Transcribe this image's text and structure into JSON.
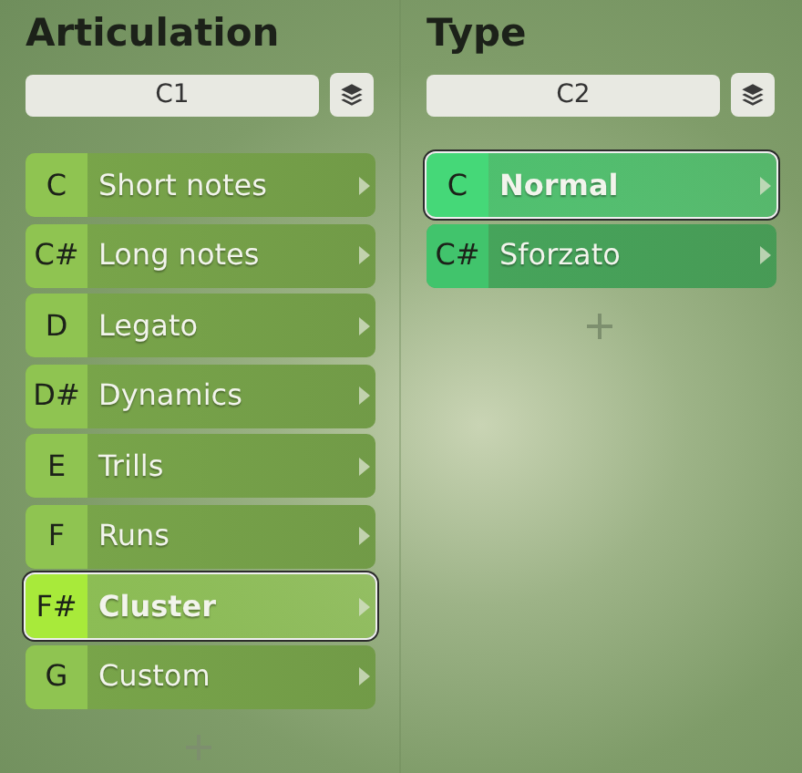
{
  "columns": [
    {
      "title": "Articulation",
      "field": "C1",
      "color": "#8fc451",
      "items": [
        {
          "key": "C",
          "label": "Short notes",
          "selected": false
        },
        {
          "key": "C#",
          "label": "Long notes",
          "selected": false
        },
        {
          "key": "D",
          "label": "Legato",
          "selected": false
        },
        {
          "key": "D#",
          "label": "Dynamics",
          "selected": false
        },
        {
          "key": "E",
          "label": "Trills",
          "selected": false
        },
        {
          "key": "F",
          "label": "Runs",
          "selected": false
        },
        {
          "key": "F#",
          "label": "Cluster",
          "selected": true
        },
        {
          "key": "G",
          "label": "Custom",
          "selected": false
        }
      ]
    },
    {
      "title": "Type",
      "field": "C2",
      "color": "#41c46c",
      "items": [
        {
          "key": "C",
          "label": "Normal",
          "selected": true
        },
        {
          "key": "C#",
          "label": "Sforzato",
          "selected": false
        }
      ]
    }
  ]
}
